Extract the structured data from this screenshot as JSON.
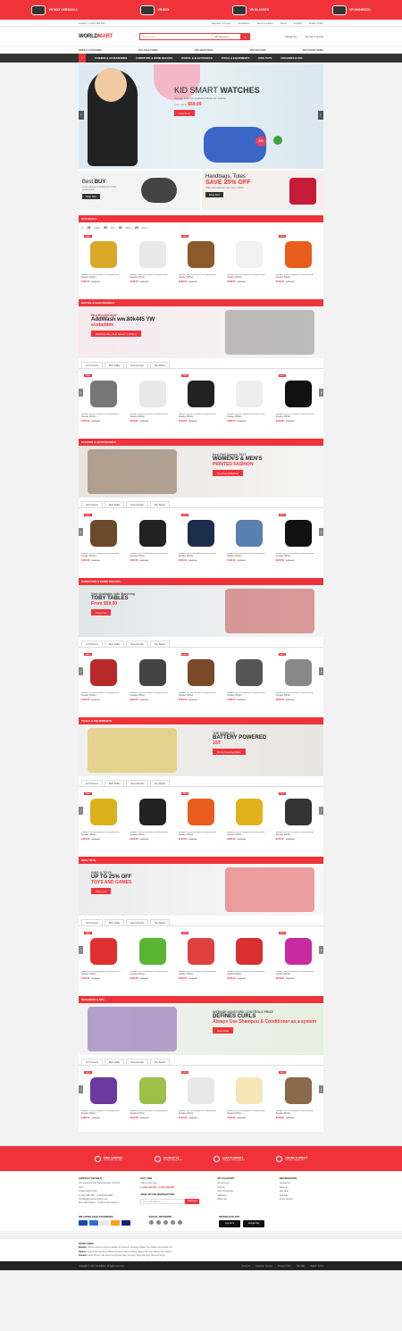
{
  "top_banner": [
    "VR BOX VERSION 2",
    "VR BOX",
    "VR GLASSES",
    "VR SHINECON"
  ],
  "topbar": {
    "hotline": "Hotline: (+123) 456 789",
    "links": [
      "Register or Login",
      "Newsletter",
      "Store Location",
      "About"
    ],
    "lang": "English",
    "currency": "Dollar (USD)"
  },
  "header": {
    "logo_a": "WORLD",
    "logo_b": "MART",
    "search_placeholder": "Search here...",
    "category": "All Categories",
    "wishlist": "Wishlist (0)",
    "cart": "My Cart 0 Item(s)"
  },
  "subnav": [
    "WEEKLY FEATURED",
    "HOT SALE ITEMS",
    "TOP NEW ITEMS",
    "TOP SELLERS",
    "TOP RATED ITEMS"
  ],
  "mainnav": [
    "FASHION & ACCESSORIES",
    "FURNITURE & HOME DECORS",
    "DIGITAL & ELECTRONICS",
    "TOOLS & EQUIPMENTS",
    "KIDS TOYS",
    "ORGANICS & SPA"
  ],
  "slider": {
    "h1": "KID SMART",
    "h2": "WATCHES",
    "sub": "Compra todos los productos Smart por internet.",
    "price_label": "Only price:",
    "price": "$59.99",
    "btn": "Shop Now",
    "badge": "3G"
  },
  "promo": {
    "b1_title_a": "Best ",
    "b1_title_b": "BUY",
    "b1_text": "Lorem Ipsum is simply text of the printing and...",
    "b1_btn": "Shop Now",
    "b2_title": "Handbags, Totes",
    "b2_save": "SAVE 25% OFF",
    "b2_text": "Offer and selection may vary in Store",
    "b2_btn": "Shop Now"
  },
  "hot_deals": {
    "title": "HOT DEALS",
    "countdown": [
      {
        "n": "05",
        "l": "Days"
      },
      {
        "n": "20",
        "l": "Hrs"
      },
      {
        "n": "40",
        "l": "Mins"
      },
      {
        "n": "25",
        "l": "Secs"
      }
    ]
  },
  "tabs": [
    "All Products",
    "Best Seller",
    "New Arrivals",
    "Top Rated"
  ],
  "sections": [
    {
      "title": "DIGITAL & ELECTRONICS",
      "banner": {
        "a": "8Kg Bundle deal*",
        "b": "AddWash ww.80k445 YW",
        "c": "ecobubble",
        "d": "Washing: 8kg, Spin Speed: 1,400rpm"
      }
    },
    {
      "title": "FASHION & ACCESSORIES",
      "banner": {
        "a": "New Fall Season 2017",
        "b": "WOMEN'S & MEN'S",
        "c": "PRINTED FASHION",
        "d": "Amazing Collection"
      }
    },
    {
      "title": "FURNITURE & HOME DECORS",
      "banner": {
        "a": "Now Available with Matching",
        "b": "TOBY TABLES",
        "c": "From $59.00",
        "d": "Shop now"
      }
    },
    {
      "title": "TOOLS & EQUIPMENTS",
      "banner": {
        "a": "THE WORLD'S",
        "b": "BATTERY POWERED",
        "c": "1ST",
        "d": "90mm Framing Nailer"
      }
    },
    {
      "title": "KIDS TOYS",
      "banner": {
        "a": "KIDS & TOYS",
        "b": "UP TO 25% OFF",
        "c": "TOYS AND GAMES",
        "d": "Shop now"
      }
    },
    {
      "title": "ORGANICS & SPA",
      "banner": {
        "a": "INTENSE MOISTURE CONTROLS FRIZZ",
        "b": "DEFINES CURLS",
        "c": "Always Use Shampoo & Conditioner as a system",
        "d": "Shop Now"
      }
    }
  ],
  "prod_name": "Radiant 360 R6 Wireless Omnidirectional Speaker [White]",
  "price": "$168.00",
  "old_price": "$180.00",
  "features": [
    {
      "t": "FREE SHIPPING",
      "d": "On all order over $99"
    },
    {
      "t": "GUARANTEE",
      "d": "30 Days Money Back"
    },
    {
      "t": "SAFE PAYMENTS",
      "d": "Safe your online payment"
    },
    {
      "t": "ONLINE SUPPORT",
      "d": "We have support 24/7"
    }
  ],
  "footer": {
    "contact_title": "CONTACT DETAILS",
    "address": "45 Grand Central Terminal New York,NY 1017",
    "address2": "United State USA",
    "phone": "(+123) 456 789 - (+123) 666 888",
    "email": "Contact@yourcompany.com",
    "hours": "Mon-Sat 9:00pm - 5:00pm Sun:Closed",
    "hotline_title": "HOT LINE",
    "hotline_text": "Call Us toll Free",
    "hotline_num": "(+123) 456 789 - (+123) 666 888",
    "signup_title": "SIGN UP FOR NEWSLETTER",
    "signup_placeholder": "Your email address...",
    "signup_btn": "Subscribe",
    "account_title": "MY ACCOUNT",
    "account": [
      "My Account",
      "Brands",
      "Gift Certificates",
      "Affiliates",
      "Wish List"
    ],
    "info_title": "INFORMATION",
    "info": [
      "Contact Us",
      "Returns",
      "Site Map",
      "Specials",
      "Order History"
    ],
    "pay_title": "WE USING SAFE PAYMENTS:",
    "social_title": "SOCIAL NETWORK",
    "app_title": "DOWNLOAD APP",
    "app1": "App Store",
    "app2": "Google Play"
  },
  "quick": {
    "title": "QUICK LINKS",
    "rows": [
      {
        "k": "Mobiles:",
        "v": "Mobiles  Iphones  Cameras  Mobile 3G  Wireless Speakers  Mobile Free  Mobile New  Mobile Old"
      },
      {
        "k": "Tablets:",
        "v": "Apple iPads  Samsung Tablets  Windows Tablets  Calling Tablets  Microsoft Tablets  Asus Tablets"
      },
      {
        "k": "Fashion:",
        "v": "Dress  Women Silk  Jeans  Sunglasses  Baby Jewellery  Rings  Earrings  Diamond Rings"
      }
    ]
  },
  "bottom": {
    "copy": "Copyright © 2017 WorldMart. All rights reserved",
    "links": [
      "About Us",
      "Customer Service",
      "Privacy Policy",
      "Site Map",
      "Search Terms"
    ]
  }
}
